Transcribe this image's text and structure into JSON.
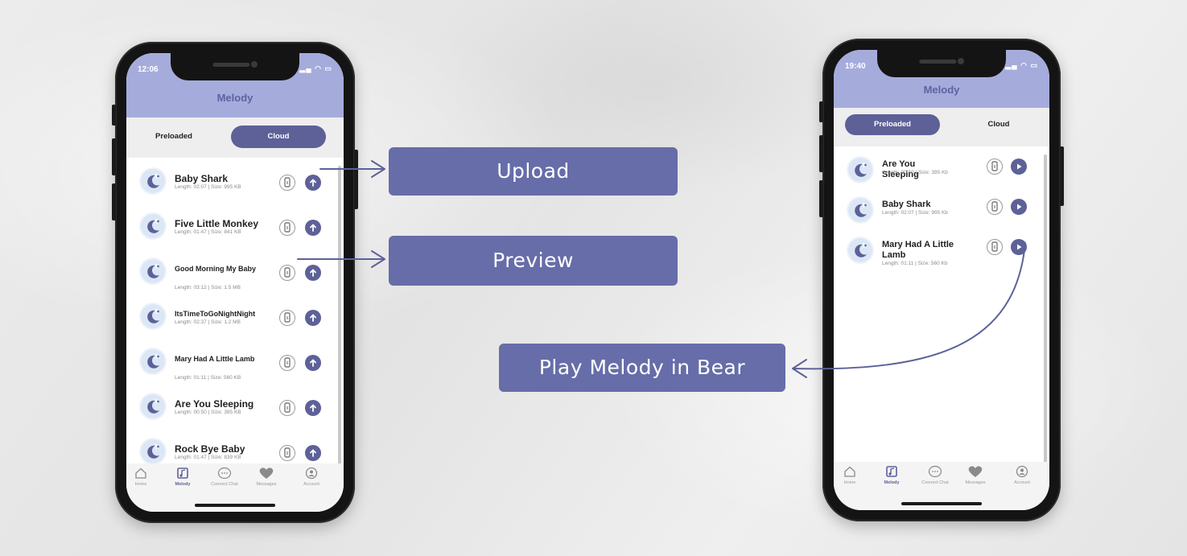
{
  "left_phone": {
    "status_time": "12:06",
    "header_title": "Melody",
    "segments": [
      {
        "label": "Preloaded",
        "active": false
      },
      {
        "label": "Cloud",
        "active": true
      }
    ],
    "items": [
      {
        "name": "Baby Shark",
        "meta": "Length: 02:07 | Size: 995 KB",
        "action": "upload"
      },
      {
        "name": "Five Little Monkey",
        "meta": "Length: 01:47 | Size: 841 KB",
        "action": "upload"
      },
      {
        "name": "Good Morning My Baby",
        "meta": "Length: 03:12 | Size: 1.5 MB",
        "action": "upload"
      },
      {
        "name": "ItsTimeToGoNightNight",
        "meta": "Length: 02:37 | Size: 1.2 MB",
        "action": "upload"
      },
      {
        "name": "Mary Had A Little Lamb",
        "meta": "Length: 01:11 | Size: 560 KB",
        "action": "upload"
      },
      {
        "name": "Are You Sleeping",
        "meta": "Length: 00:50 | Size: 395 KB",
        "action": "upload"
      },
      {
        "name": "Rock Bye Baby",
        "meta": "Length: 01:47 | Size: 839 KB",
        "action": "upload"
      }
    ],
    "tabs": [
      {
        "label": "Home",
        "icon": "home-icon",
        "active": false
      },
      {
        "label": "Melody",
        "icon": "melody-icon",
        "active": true
      },
      {
        "label": "Connect Chat",
        "icon": "chat-icon",
        "active": false
      },
      {
        "label": "Messages",
        "icon": "heart-icon",
        "active": false
      },
      {
        "label": "Account",
        "icon": "account-icon",
        "active": false
      }
    ]
  },
  "right_phone": {
    "status_time": "19:40",
    "header_title": "Melody",
    "segments": [
      {
        "label": "Preloaded",
        "active": true
      },
      {
        "label": "Cloud",
        "active": false
      }
    ],
    "items": [
      {
        "name": "Are You Sleeping",
        "meta": "Length: 00:50 | Size: 395 Kb",
        "action": "play"
      },
      {
        "name": "Baby Shark",
        "meta": "Length: 02:07 | Size: 995 Kb",
        "action": "play"
      },
      {
        "name": "Mary Had A Little Lamb",
        "meta": "Length: 01:11 | Size: 560 Kb",
        "action": "play"
      }
    ],
    "tabs": [
      {
        "label": "Home",
        "icon": "home-icon",
        "active": false
      },
      {
        "label": "Melody",
        "icon": "melody-icon",
        "active": true
      },
      {
        "label": "Connect Chat",
        "icon": "chat-icon",
        "active": false
      },
      {
        "label": "Messages",
        "icon": "heart-icon",
        "active": false
      },
      {
        "label": "Account",
        "icon": "account-icon",
        "active": false
      }
    ]
  },
  "callouts": {
    "upload": "Upload",
    "preview": "Preview",
    "play": "Play Melody in Bear"
  },
  "colors": {
    "accent": "#5d6198",
    "header": "#a5acdc",
    "callout": "#666da8"
  }
}
